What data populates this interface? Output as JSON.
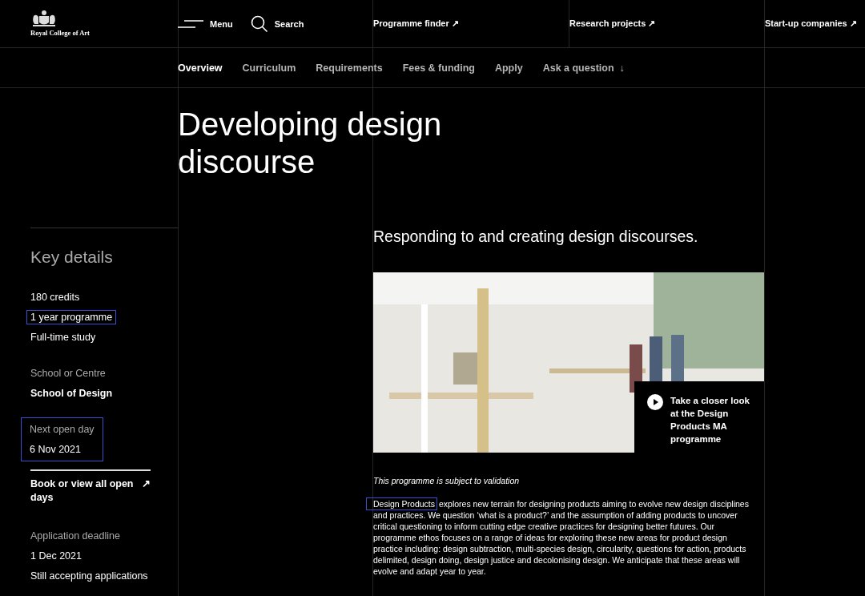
{
  "header": {
    "logo": "Royal College of Art",
    "tools": [
      {
        "kind": "menu",
        "label": "Menu"
      },
      {
        "kind": "search",
        "label": "Search"
      }
    ],
    "links": [
      {
        "label": "Programme finder",
        "arrow": "↗"
      },
      {
        "label": "Research projects",
        "arrow": "↗"
      },
      {
        "label": "Start-up companies",
        "arrow": "↗"
      }
    ]
  },
  "subnav": [
    {
      "label": "Overview",
      "selected": true
    },
    {
      "label": "Curriculum",
      "selected": false
    },
    {
      "label": "Requirements",
      "selected": false
    },
    {
      "label": "Fees & funding",
      "selected": false
    },
    {
      "label": "Apply",
      "selected": false
    },
    {
      "label": "Ask a question",
      "selected": false,
      "arrow": "↓"
    }
  ],
  "title": "Developing design discourse",
  "sidebar": {
    "title": "Key details",
    "sections": [
      {
        "kind": "group",
        "highlighted": false,
        "items": [
          {
            "kind": "value",
            "text": "180 credits",
            "highlighted": false
          },
          {
            "kind": "value",
            "text": "1 year programme",
            "highlighted": true
          },
          {
            "kind": "value",
            "text": "Full-time study",
            "highlighted": false
          }
        ]
      },
      {
        "kind": "group",
        "highlighted": false,
        "items": [
          {
            "kind": "label",
            "text": "School or Centre",
            "highlighted": false
          },
          {
            "kind": "bold",
            "text": "School of Design",
            "highlighted": false
          }
        ]
      },
      {
        "kind": "group",
        "highlighted": true,
        "items": [
          {
            "kind": "label",
            "text": "Next open day",
            "highlighted": false
          },
          {
            "kind": "value",
            "text": "6 Nov 2021",
            "highlighted": false
          }
        ]
      },
      {
        "kind": "link",
        "text": "Book or view all open days",
        "arrow": "↗"
      },
      {
        "kind": "group",
        "highlighted": false,
        "items": [
          {
            "kind": "label",
            "text": "Application deadline",
            "highlighted": false
          },
          {
            "kind": "value",
            "text": "1 Dec 2021",
            "highlighted": false
          },
          {
            "kind": "value",
            "text": "Still accepting applications",
            "highlighted": false
          }
        ]
      }
    ]
  },
  "main": {
    "subtitle": "Responding to and creating design discourses.",
    "video_caption": "Take a closer look at the Design Products MA programme",
    "note": "This programme is subject to validation",
    "paragraph": {
      "lead": "Design Products",
      "lead_highlighted": true,
      "text": "explores new terrain for designing products aiming to evolve new design disciplines and practices. We question ‘what is a product?’ and the assumption of adding products to uncover critical questioning to inform cutting edge creative practices for designing better futures. Our programme ethos focuses on a range of ideas for exploring these new areas for product design practice including: design subtraction, multi-species design, circularity, questions for action, products delimited, design doing, design justice and decolonising design. We anticipate that these areas will evolve and adapt year to year."
    }
  }
}
